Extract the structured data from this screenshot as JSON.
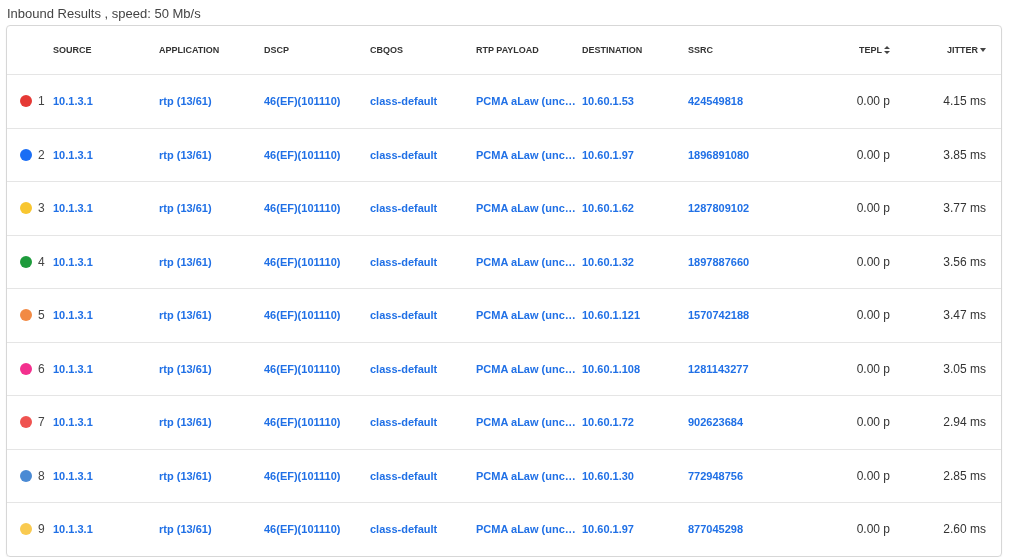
{
  "title": "Inbound Results , speed: 50 Mb/s",
  "table": {
    "columns": [
      {
        "label": "SOURCE"
      },
      {
        "label": "APPLICATION"
      },
      {
        "label": "DSCP"
      },
      {
        "label": "CBQOS"
      },
      {
        "label": "RTP PAYLOAD"
      },
      {
        "label": "DESTINATION"
      },
      {
        "label": "SSRC"
      },
      {
        "label": "TEPL",
        "sortable": true,
        "sorted": false
      },
      {
        "label": "JITTER",
        "sortable": true,
        "sorted": true
      }
    ],
    "rows": [
      {
        "color": "#e53935",
        "number": "1",
        "source": "10.1.3.1",
        "application": "rtp (13/61)",
        "dscp": "46(EF)(101110)",
        "cbqos": "class-default",
        "rtp_payload": "PCMA aLaw (unc…",
        "destination": "10.60.1.53",
        "ssrc": "424549818",
        "tepl": "0.00 p",
        "jitter": "4.15 ms"
      },
      {
        "color": "#1a6ef5",
        "number": "2",
        "source": "10.1.3.1",
        "application": "rtp (13/61)",
        "dscp": "46(EF)(101110)",
        "cbqos": "class-default",
        "rtp_payload": "PCMA aLaw (unc…",
        "destination": "10.60.1.97",
        "ssrc": "1896891080",
        "tepl": "0.00 p",
        "jitter": "3.85 ms"
      },
      {
        "color": "#f8c630",
        "number": "3",
        "source": "10.1.3.1",
        "application": "rtp (13/61)",
        "dscp": "46(EF)(101110)",
        "cbqos": "class-default",
        "rtp_payload": "PCMA aLaw (unc…",
        "destination": "10.60.1.62",
        "ssrc": "1287809102",
        "tepl": "0.00 p",
        "jitter": "3.77 ms"
      },
      {
        "color": "#1e9b3c",
        "number": "4",
        "source": "10.1.3.1",
        "application": "rtp (13/61)",
        "dscp": "46(EF)(101110)",
        "cbqos": "class-default",
        "rtp_payload": "PCMA aLaw (unc…",
        "destination": "10.60.1.32",
        "ssrc": "1897887660",
        "tepl": "0.00 p",
        "jitter": "3.56 ms"
      },
      {
        "color": "#f28a44",
        "number": "5",
        "source": "10.1.3.1",
        "application": "rtp (13/61)",
        "dscp": "46(EF)(101110)",
        "cbqos": "class-default",
        "rtp_payload": "PCMA aLaw (unc…",
        "destination": "10.60.1.121",
        "ssrc": "1570742188",
        "tepl": "0.00 p",
        "jitter": "3.47 ms"
      },
      {
        "color": "#f3308e",
        "number": "6",
        "source": "10.1.3.1",
        "application": "rtp (13/61)",
        "dscp": "46(EF)(101110)",
        "cbqos": "class-default",
        "rtp_payload": "PCMA aLaw (unc…",
        "destination": "10.60.1.108",
        "ssrc": "1281143277",
        "tepl": "0.00 p",
        "jitter": "3.05 ms"
      },
      {
        "color": "#ef5350",
        "number": "7",
        "source": "10.1.3.1",
        "application": "rtp (13/61)",
        "dscp": "46(EF)(101110)",
        "cbqos": "class-default",
        "rtp_payload": "PCMA aLaw (unc…",
        "destination": "10.60.1.72",
        "ssrc": "902623684",
        "tepl": "0.00 p",
        "jitter": "2.94 ms"
      },
      {
        "color": "#4a8ad4",
        "number": "8",
        "source": "10.1.3.1",
        "application": "rtp (13/61)",
        "dscp": "46(EF)(101110)",
        "cbqos": "class-default",
        "rtp_payload": "PCMA aLaw (unc…",
        "destination": "10.60.1.30",
        "ssrc": "772948756",
        "tepl": "0.00 p",
        "jitter": "2.85 ms"
      },
      {
        "color": "#f9ca50",
        "number": "9",
        "source": "10.1.3.1",
        "application": "rtp (13/61)",
        "dscp": "46(EF)(101110)",
        "cbqos": "class-default",
        "rtp_payload": "PCMA aLaw (unc…",
        "destination": "10.60.1.97",
        "ssrc": "877045298",
        "tepl": "0.00 p",
        "jitter": "2.60 ms"
      }
    ]
  }
}
